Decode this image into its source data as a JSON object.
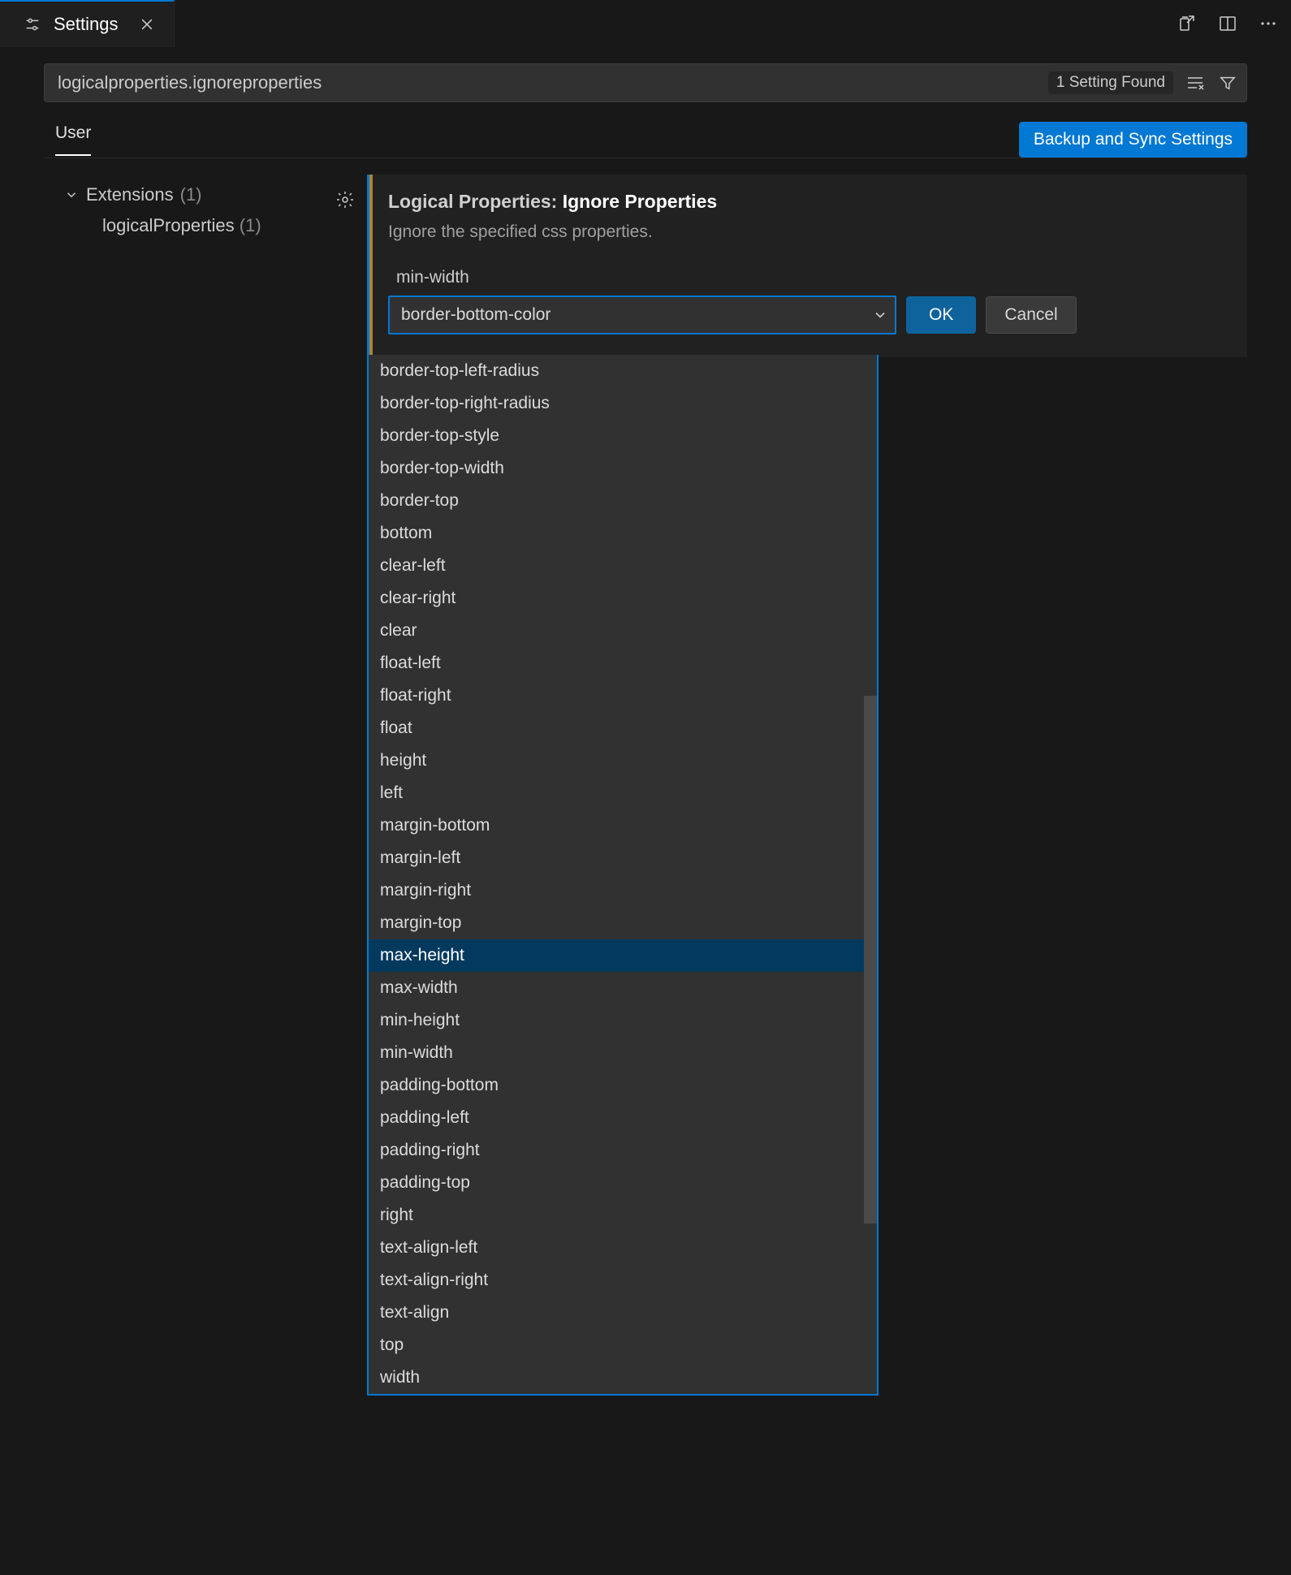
{
  "tab": {
    "label": "Settings"
  },
  "search": {
    "value": "logicalproperties.ignoreproperties",
    "badge": "1 Setting Found"
  },
  "scope": {
    "tabs": [
      "User"
    ],
    "sync_button": "Backup and Sync Settings"
  },
  "tree": {
    "group_label": "Extensions",
    "group_count": "(1)",
    "item_label": "logicalProperties",
    "item_count": "(1)"
  },
  "setting": {
    "category": "Logical Properties: ",
    "name": "Ignore Properties",
    "description": "Ignore the specified css properties.",
    "list_header": "min-width",
    "combo_value": "border-bottom-color",
    "ok_label": "OK",
    "cancel_label": "Cancel"
  },
  "dropdown": {
    "selected_index": 18,
    "options": [
      "border-top-left-radius",
      "border-top-right-radius",
      "border-top-style",
      "border-top-width",
      "border-top",
      "bottom",
      "clear-left",
      "clear-right",
      "clear",
      "float-left",
      "float-right",
      "float",
      "height",
      "left",
      "margin-bottom",
      "margin-left",
      "margin-right",
      "margin-top",
      "max-height",
      "max-width",
      "min-height",
      "min-width",
      "padding-bottom",
      "padding-left",
      "padding-right",
      "padding-top",
      "right",
      "text-align-left",
      "text-align-right",
      "text-align",
      "top",
      "width"
    ]
  }
}
